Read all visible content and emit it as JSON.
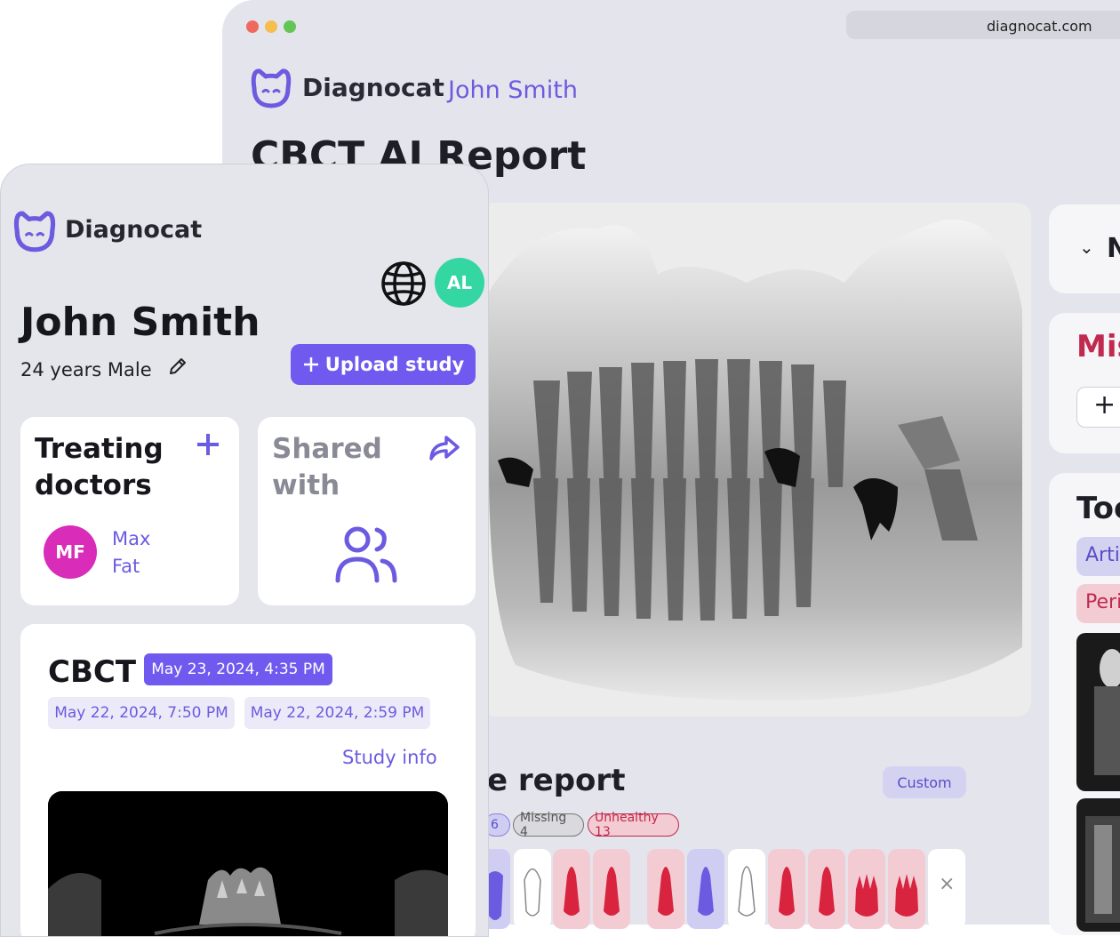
{
  "browser": {
    "url": "diagnocat.com",
    "brand": "Diagnocat",
    "user_name": "John Smith",
    "page_title": "CBCT AI Report",
    "traffic_light_colors": [
      "#ee6a5f",
      "#f5be4f",
      "#62c554"
    ],
    "report": {
      "title_partial": "e report",
      "custom_button": "Custom",
      "chip_count": "6",
      "chip_missing": "Missing 4",
      "chip_unhealthy": "Unhealthy 13",
      "close_icon": "×"
    },
    "side_panel": {
      "card1_text": "N",
      "card2_title": "Mis",
      "card2_plus": "+",
      "card3_title": "Too",
      "tag_1": "Arti",
      "tag_2": "Peri"
    }
  },
  "mobile": {
    "brand": "Diagnocat",
    "user_initials": "AL",
    "patient": {
      "name": "John Smith",
      "age": "24 years",
      "sex": "Male"
    },
    "upload_button": "Upload study",
    "treating_doctors": {
      "title": "Treating doctors",
      "doctor_initials": "MF",
      "doctor_name": "Max Fat"
    },
    "shared_with": {
      "title": "Shared with"
    },
    "study": {
      "type": "CBCT",
      "selected_date": "May 23, 2024, 4:35 PM",
      "other_dates": [
        "May 22, 2024, 7:50 PM",
        "May 22, 2024, 2:59 PM"
      ],
      "info_link": "Study info"
    }
  },
  "colors": {
    "accent": "#7059ee",
    "accent_text": "#6b5be0",
    "unhealthy": "#c02a4e",
    "avatar_al": "#34d6a2",
    "avatar_mf": "#d92cb9"
  }
}
